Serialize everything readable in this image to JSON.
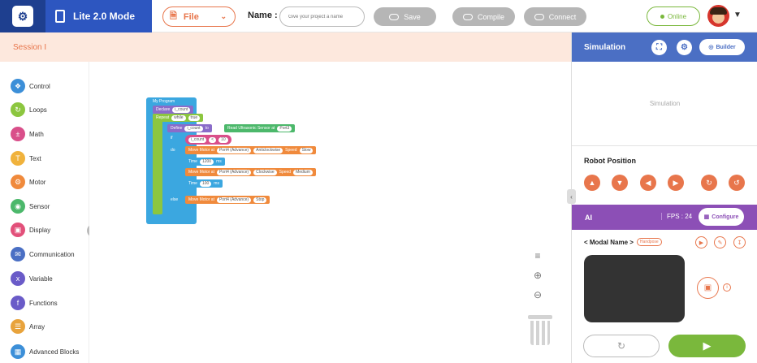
{
  "header": {
    "mode_label": "Lite 2.0 Mode",
    "file_label": "File",
    "name_label": "Name :",
    "name_placeholder": "Give your project a name",
    "save_label": "Save",
    "compile_label": "Compile",
    "connect_label": "Connect",
    "status_label": "Online"
  },
  "session": {
    "title": "Session I"
  },
  "sidebar": {
    "categories": [
      {
        "label": "Control",
        "icon": "control-icon",
        "color": "#3c8fd8"
      },
      {
        "label": "Loops",
        "icon": "loops-icon",
        "color": "#8cc63f"
      },
      {
        "label": "Math",
        "icon": "math-icon",
        "color": "#d94f8a"
      },
      {
        "label": "Text",
        "icon": "text-icon",
        "color": "#f0b23c"
      },
      {
        "label": "Motor",
        "icon": "motor-icon",
        "color": "#f08a3c"
      },
      {
        "label": "Sensor",
        "icon": "sensor-icon",
        "color": "#4cb86b"
      },
      {
        "label": "Display",
        "icon": "display-icon",
        "color": "#e2507a"
      },
      {
        "label": "Communication",
        "icon": "communication-icon",
        "color": "#4a6fc4"
      },
      {
        "label": "Variable",
        "icon": "variable-icon",
        "color": "#6a5bc8"
      },
      {
        "label": "Functions",
        "icon": "functions-icon",
        "color": "#6a5bc8"
      },
      {
        "label": "Array",
        "icon": "array-icon",
        "color": "#e8a33c"
      },
      {
        "label": "Advanced Blocks",
        "icon": "advanced-blocks-icon",
        "color": "#3c8fd8"
      }
    ]
  },
  "blocks": {
    "program": "My Program",
    "declare": "Declare",
    "count_var": "i_count",
    "repeat": "Repeat",
    "while_kw": "while",
    "true_val": "true",
    "define": "Define",
    "to": "to",
    "read_sensor": "Read Ultrasonic Sensor at",
    "port3": "Port3",
    "if_kw": "if",
    "lt": "<",
    "ten": "10",
    "do_kw": "do",
    "move_motor": "Move Motor at",
    "port4_adv": "Port4 (Advance)",
    "anticlockwise": "Anticlockwise",
    "speed": "Speed",
    "slow": "Slow",
    "time": "Time",
    "t1200": "1200",
    "ms": "ms",
    "clockwise": "Clockwise",
    "medium": "Medium",
    "t100": "100",
    "else_kw": "else",
    "stop": "Stop"
  },
  "simulation": {
    "title": "Simulation",
    "builder_label": "Builder",
    "placeholder": "Simulation",
    "robot_position_label": "Robot Position"
  },
  "ai": {
    "title": "AI",
    "fps": "FPS : 24",
    "configure_label": "Configure",
    "modal_name": "< Modal Name >",
    "model_badge": "Handpose"
  },
  "colors": {
    "primary_blue": "#2d56c0",
    "accent_orange": "#e8764c",
    "ai_purple": "#8c4fb6",
    "online_green": "#7ab83c"
  }
}
